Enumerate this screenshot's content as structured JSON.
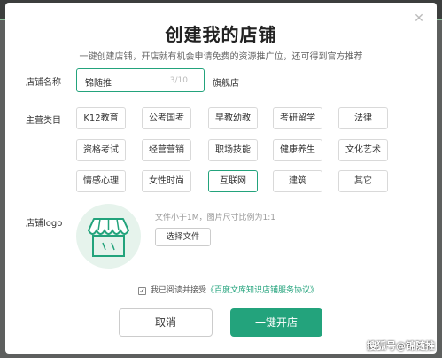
{
  "dialog": {
    "title": "创建我的店铺",
    "subtitle": "一键创建店铺，开店就有机会申请免费的资源推广位，还可得到官方推荐",
    "close_icon": "close-icon"
  },
  "shop_name": {
    "label": "店铺名称",
    "value": "锦随推",
    "counter": "3/10",
    "suffix": "旗舰店"
  },
  "category": {
    "label": "主营类目",
    "selected": "互联网",
    "items": [
      "K12教育",
      "公考国考",
      "早教幼教",
      "考研留学",
      "法律",
      "资格考试",
      "经营营销",
      "职场技能",
      "健康养生",
      "文化艺术",
      "情感心理",
      "女性时尚",
      "互联网",
      "建筑",
      "其它"
    ]
  },
  "logo": {
    "label": "店铺logo",
    "hint": "文件小于1M，图片尺寸比例为1:1",
    "upload_label": "选择文件",
    "placeholder_icon": "storefront-icon"
  },
  "agreement": {
    "checked": true,
    "prefix": "我已阅读并接受",
    "link": "《百度文库知识店铺服务协议》"
  },
  "buttons": {
    "cancel": "取消",
    "confirm": "一键开店"
  },
  "watermark": "搜狐号@锦随推",
  "colors": {
    "accent": "#23a37c",
    "overlay": "#5d5f5e"
  }
}
